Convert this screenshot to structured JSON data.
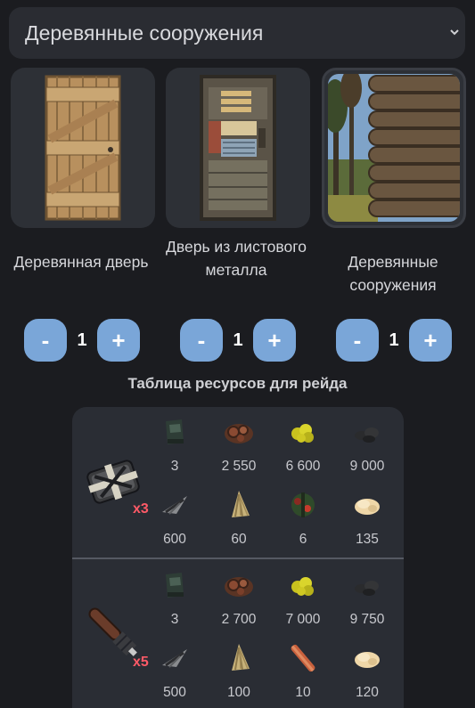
{
  "dropdown": {
    "selected": "Деревянные сооружения",
    "icon": "chevron-down-icon"
  },
  "items": [
    {
      "name": "Деревянная дверь",
      "quantity": "1",
      "minus": "-",
      "plus": "+"
    },
    {
      "name": "Дверь из листового металла",
      "quantity": "1",
      "minus": "-",
      "plus": "+"
    },
    {
      "name": "Деревянные сооружения",
      "quantity": "1",
      "minus": "-",
      "plus": "+"
    }
  ],
  "raid_table": {
    "title": "Таблица ресурсов для рейда",
    "rows": [
      {
        "weapon_icon": "satchel-charge-icon",
        "multiplier": "x3",
        "resources": [
          {
            "icon": "gunpowder-icon",
            "value": "3"
          },
          {
            "icon": "metal-fragments-icon",
            "value": "2 550"
          },
          {
            "icon": "sulfur-icon",
            "value": "6 600"
          },
          {
            "icon": "charcoal-icon",
            "value": "9 000"
          },
          {
            "icon": "rope-icon",
            "value": "600"
          },
          {
            "icon": "cloth-icon",
            "value": "60"
          },
          {
            "icon": "beancan-grenade-icon",
            "value": "6"
          },
          {
            "icon": "animal-fat-icon",
            "value": "135"
          }
        ]
      },
      {
        "weapon_icon": "rocket-icon",
        "multiplier": "x5",
        "resources": [
          {
            "icon": "gunpowder-icon",
            "value": "3"
          },
          {
            "icon": "metal-fragments-icon",
            "value": "2 700"
          },
          {
            "icon": "sulfur-icon",
            "value": "7 000"
          },
          {
            "icon": "charcoal-icon",
            "value": "9 750"
          },
          {
            "icon": "rope-icon",
            "value": "500"
          },
          {
            "icon": "cloth-icon",
            "value": "100"
          },
          {
            "icon": "metal-pipe-icon",
            "value": "10"
          },
          {
            "icon": "animal-fat-icon",
            "value": "120"
          }
        ]
      }
    ]
  }
}
